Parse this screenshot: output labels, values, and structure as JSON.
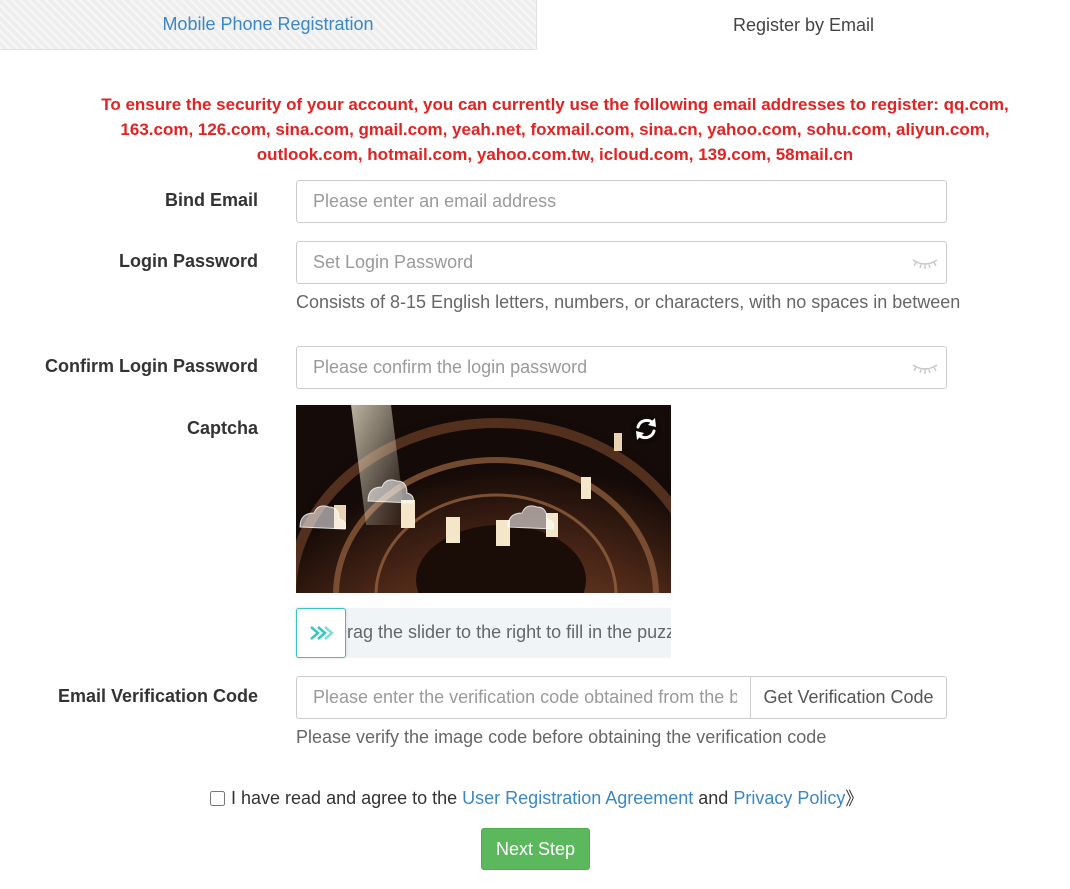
{
  "tabs": {
    "mobile": "Mobile Phone Registration",
    "email": "Register by Email"
  },
  "notice": "To ensure the security of your account, you can currently use the following email addresses to register: qq.com, 163.com, 126.com, sina.com, gmail.com, yeah.net, foxmail.com, sina.cn, yahoo.com, sohu.com, aliyun.com, outlook.com, hotmail.com, yahoo.com.tw, icloud.com, 139.com, 58mail.cn",
  "form": {
    "email": {
      "label": "Bind Email",
      "placeholder": "Please enter an email address",
      "value": ""
    },
    "password": {
      "label": "Login Password",
      "placeholder": "Set Login Password",
      "value": "",
      "hint": "Consists of 8-15 English letters, numbers, or characters, with no spaces in between"
    },
    "confirm": {
      "label": "Confirm Login Password",
      "placeholder": "Please confirm the login password",
      "value": ""
    },
    "captcha": {
      "label": "Captcha",
      "slider_text": "Drag the slider to the right to fill in the puzzle",
      "slider_progress": 0
    },
    "code": {
      "label": "Email Verification Code",
      "placeholder": "Please enter the verification code obtained from the box",
      "value": "",
      "button": "Get Verification Code",
      "hint": "Please verify the image code before obtaining the verification code"
    }
  },
  "agreement": {
    "prefix": "I have read and agree to the ",
    "link1": "User Registration Agreement",
    "middle": " and ",
    "link2": "Privacy Policy",
    "suffix": "》",
    "checked": false
  },
  "next_button": "Next Step",
  "colors": {
    "notice": "#e02323",
    "link": "#3a87c8",
    "primary_button": "#5cb85c",
    "slider_accent": "#36c5c0"
  },
  "icons": {
    "password_toggle": "eye-closed-icon",
    "refresh": "refresh-icon",
    "slider": "double-chevron-right-icon"
  }
}
